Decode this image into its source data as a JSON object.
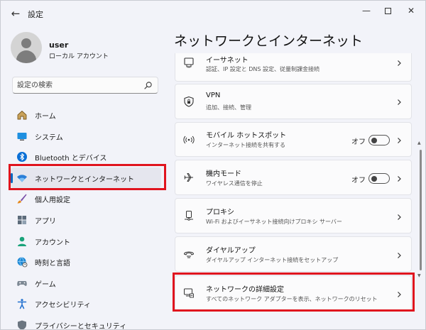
{
  "window": {
    "app_title": "設定"
  },
  "profile": {
    "name": "user",
    "account_type": "ローカル アカウント"
  },
  "search": {
    "placeholder": "設定の検索"
  },
  "sidebar": {
    "items": [
      {
        "label": "ホーム",
        "icon": "home-icon"
      },
      {
        "label": "システム",
        "icon": "system-icon"
      },
      {
        "label": "Bluetooth とデバイス",
        "icon": "bluetooth-icon"
      },
      {
        "label": "ネットワークとインターネット",
        "icon": "wifi-icon",
        "active": true
      },
      {
        "label": "個人用設定",
        "icon": "brush-icon"
      },
      {
        "label": "アプリ",
        "icon": "apps-icon"
      },
      {
        "label": "アカウント",
        "icon": "account-icon"
      },
      {
        "label": "時刻と言語",
        "icon": "globe-clock-icon"
      },
      {
        "label": "ゲーム",
        "icon": "gamepad-icon"
      },
      {
        "label": "アクセシビリティ",
        "icon": "accessibility-icon"
      },
      {
        "label": "プライバシーとセキュリティ",
        "icon": "shield-icon"
      }
    ]
  },
  "main": {
    "title": "ネットワークとインターネット",
    "settings": [
      {
        "title": "イーサネット",
        "desc": "認証、IP 設定と DNS 設定、従量制課金接続",
        "icon": "ethernet-icon"
      },
      {
        "title": "VPN",
        "desc": "追加、接続、管理",
        "icon": "vpn-shield-icon"
      },
      {
        "title": "モバイル ホットスポット",
        "desc": "インターネット接続を共有する",
        "icon": "hotspot-icon",
        "toggle": "オフ"
      },
      {
        "title": "機内モード",
        "desc": "ワイヤレス通信を停止",
        "icon": "airplane-icon",
        "toggle": "オフ"
      },
      {
        "title": "プロキシ",
        "desc": "Wi-Fi およびイーサネット接続向けプロキシ サーバー",
        "icon": "proxy-icon"
      },
      {
        "title": "ダイヤルアップ",
        "desc": "ダイヤルアップ インターネット接続をセットアップ",
        "icon": "dialup-icon"
      },
      {
        "title": "ネットワークの詳細設定",
        "desc": "すべてのネットワーク アダプターを表示、ネットワークのリセット",
        "icon": "advanced-network-icon"
      }
    ]
  },
  "colors": {
    "accent": "#0067c0",
    "highlight": "#e0141e"
  }
}
